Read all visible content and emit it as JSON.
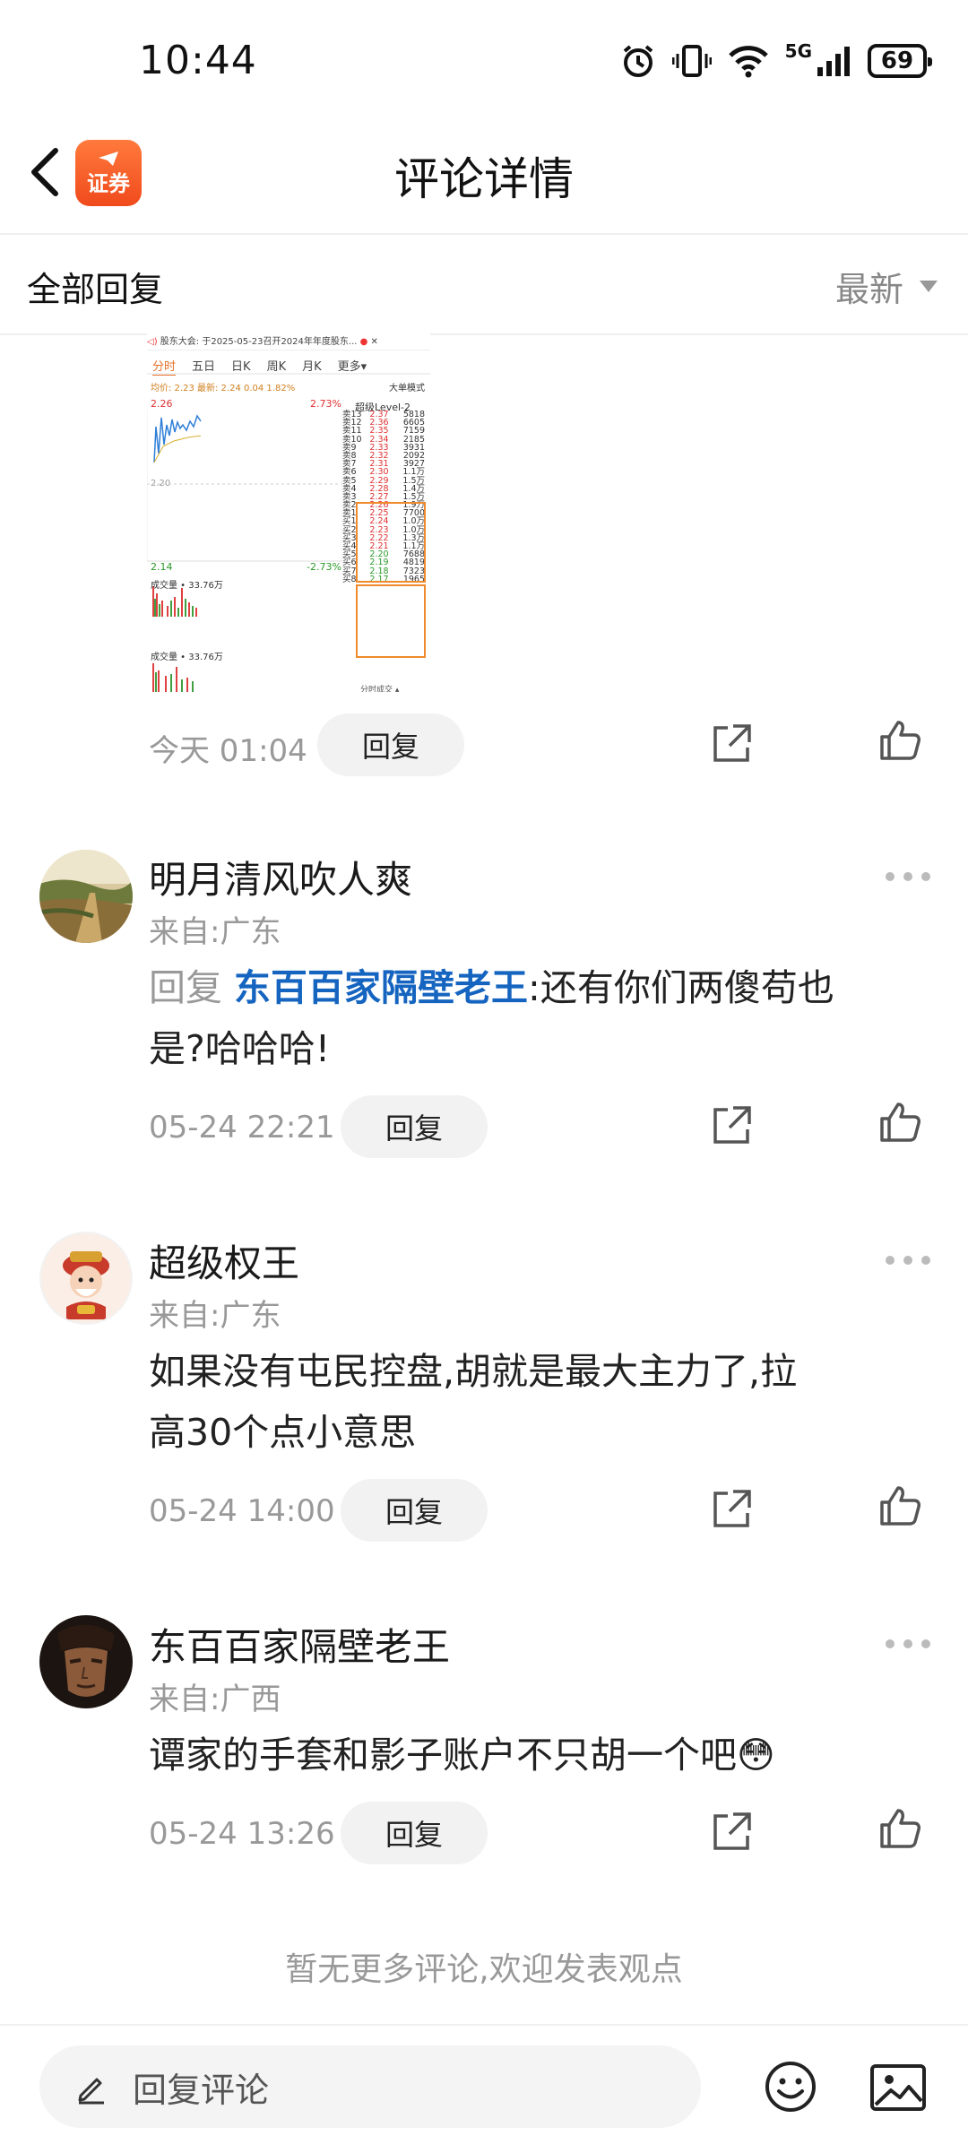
{
  "status_bar": {
    "time": "10:44",
    "network": "5G",
    "battery": "69",
    "icons": [
      "alarm-icon",
      "vibrate-icon",
      "wifi-icon",
      "signal-icon",
      "battery-icon"
    ]
  },
  "header": {
    "logo_text": "证券",
    "title": "评论详情"
  },
  "sort_bar": {
    "label": "全部回复",
    "sort_option": "最新"
  },
  "top_post": {
    "image": {
      "title": "股东大会: 于2025-05-23召开2024年年度股东...",
      "tabs": [
        "分时",
        "五日",
        "日K",
        "周K",
        "月K",
        "更多▾"
      ],
      "stats": "均价: 2.23  最新: 2.24  0.04  1.82%",
      "mode": "大单模式",
      "high": "2.26",
      "high_pct": "2.73%",
      "mid": "2.20",
      "low": "2.14",
      "low_pct": "-2.73%",
      "level": "超级Level-2",
      "volume_label": "成交量 • 33.76万",
      "footer": "分时成交 ▴",
      "orders": [
        {
          "k": "卖13",
          "p": "2.37",
          "v": "5818"
        },
        {
          "k": "卖12",
          "p": "2.36",
          "v": "6605"
        },
        {
          "k": "卖11",
          "p": "2.35",
          "v": "7159"
        },
        {
          "k": "卖10",
          "p": "2.34",
          "v": "2185"
        },
        {
          "k": "卖9",
          "p": "2.33",
          "v": "3931"
        },
        {
          "k": "卖8",
          "p": "2.32",
          "v": "2092"
        },
        {
          "k": "卖7",
          "p": "2.31",
          "v": "3927"
        },
        {
          "k": "卖6",
          "p": "2.30",
          "v": "1.1万"
        },
        {
          "k": "卖5",
          "p": "2.29",
          "v": "1.5万"
        },
        {
          "k": "卖4",
          "p": "2.28",
          "v": "1.4万"
        },
        {
          "k": "卖3",
          "p": "2.27",
          "v": "1.5万"
        },
        {
          "k": "卖2",
          "p": "2.26",
          "v": "1.9万"
        },
        {
          "k": "卖1",
          "p": "2.25",
          "v": "7700"
        },
        {
          "k": "买1",
          "p": "2.24",
          "v": "1.0万"
        },
        {
          "k": "买2",
          "p": "2.23",
          "v": "1.0万"
        },
        {
          "k": "买3",
          "p": "2.22",
          "v": "1.3万"
        },
        {
          "k": "买4",
          "p": "2.21",
          "v": "1.1万"
        },
        {
          "k": "买5",
          "p": "2.20",
          "v": "7688"
        },
        {
          "k": "买6",
          "p": "2.19",
          "v": "4819"
        },
        {
          "k": "买7",
          "p": "2.18",
          "v": "7323"
        },
        {
          "k": "买8",
          "p": "2.17",
          "v": "1965"
        }
      ]
    },
    "time": "今天 01:04",
    "reply_label": "回复"
  },
  "comments": [
    {
      "username": "明月清风吹人爽",
      "location": "来自:广东",
      "reply_prefix": "回复",
      "reply_target": "东百百家隔壁老王",
      "text_line1": ":还有你们两傻苟也",
      "text_line2": "是?哈哈哈!",
      "time": "05-24 22:21",
      "reply_label": "回复"
    },
    {
      "username": "超级权王",
      "location": "来自:广东",
      "text_line1": "如果没有屯民控盘,胡就是最大主力了,拉",
      "text_line2": "高30个点小意思",
      "time": "05-24 14:00",
      "reply_label": "回复"
    },
    {
      "username": "东百百家隔壁老王",
      "location": "来自:广西",
      "text_line1": "谭家的手套和影子账户不只胡一个吧",
      "text_emoji": "😳",
      "time": "05-24 13:26",
      "reply_label": "回复"
    }
  ],
  "end_note": "暂无更多评论,欢迎发表观点",
  "bottom_bar": {
    "placeholder": "回复评论"
  }
}
